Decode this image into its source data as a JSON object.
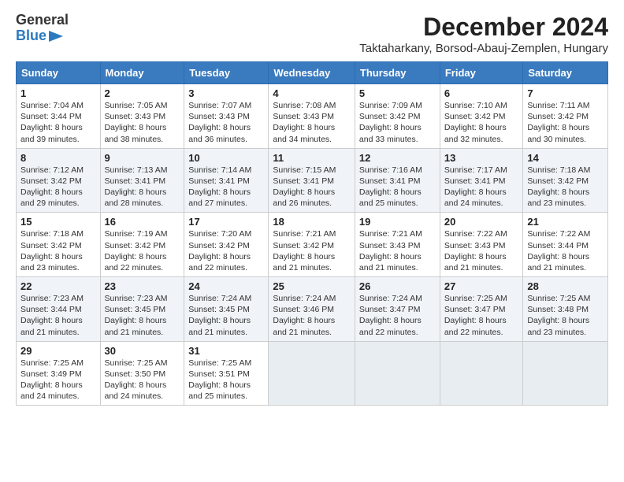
{
  "logo": {
    "general": "General",
    "blue": "Blue"
  },
  "title": "December 2024",
  "location": "Taktaharkany, Borsod-Abauj-Zemplen, Hungary",
  "days_of_week": [
    "Sunday",
    "Monday",
    "Tuesday",
    "Wednesday",
    "Thursday",
    "Friday",
    "Saturday"
  ],
  "weeks": [
    [
      {
        "day": "1",
        "sunrise": "7:04 AM",
        "sunset": "3:44 PM",
        "daylight": "8 hours and 39 minutes."
      },
      {
        "day": "2",
        "sunrise": "7:05 AM",
        "sunset": "3:43 PM",
        "daylight": "8 hours and 38 minutes."
      },
      {
        "day": "3",
        "sunrise": "7:07 AM",
        "sunset": "3:43 PM",
        "daylight": "8 hours and 36 minutes."
      },
      {
        "day": "4",
        "sunrise": "7:08 AM",
        "sunset": "3:43 PM",
        "daylight": "8 hours and 34 minutes."
      },
      {
        "day": "5",
        "sunrise": "7:09 AM",
        "sunset": "3:42 PM",
        "daylight": "8 hours and 33 minutes."
      },
      {
        "day": "6",
        "sunrise": "7:10 AM",
        "sunset": "3:42 PM",
        "daylight": "8 hours and 32 minutes."
      },
      {
        "day": "7",
        "sunrise": "7:11 AM",
        "sunset": "3:42 PM",
        "daylight": "8 hours and 30 minutes."
      }
    ],
    [
      {
        "day": "8",
        "sunrise": "7:12 AM",
        "sunset": "3:42 PM",
        "daylight": "8 hours and 29 minutes."
      },
      {
        "day": "9",
        "sunrise": "7:13 AM",
        "sunset": "3:41 PM",
        "daylight": "8 hours and 28 minutes."
      },
      {
        "day": "10",
        "sunrise": "7:14 AM",
        "sunset": "3:41 PM",
        "daylight": "8 hours and 27 minutes."
      },
      {
        "day": "11",
        "sunrise": "7:15 AM",
        "sunset": "3:41 PM",
        "daylight": "8 hours and 26 minutes."
      },
      {
        "day": "12",
        "sunrise": "7:16 AM",
        "sunset": "3:41 PM",
        "daylight": "8 hours and 25 minutes."
      },
      {
        "day": "13",
        "sunrise": "7:17 AM",
        "sunset": "3:41 PM",
        "daylight": "8 hours and 24 minutes."
      },
      {
        "day": "14",
        "sunrise": "7:18 AM",
        "sunset": "3:42 PM",
        "daylight": "8 hours and 23 minutes."
      }
    ],
    [
      {
        "day": "15",
        "sunrise": "7:18 AM",
        "sunset": "3:42 PM",
        "daylight": "8 hours and 23 minutes."
      },
      {
        "day": "16",
        "sunrise": "7:19 AM",
        "sunset": "3:42 PM",
        "daylight": "8 hours and 22 minutes."
      },
      {
        "day": "17",
        "sunrise": "7:20 AM",
        "sunset": "3:42 PM",
        "daylight": "8 hours and 22 minutes."
      },
      {
        "day": "18",
        "sunrise": "7:21 AM",
        "sunset": "3:42 PM",
        "daylight": "8 hours and 21 minutes."
      },
      {
        "day": "19",
        "sunrise": "7:21 AM",
        "sunset": "3:43 PM",
        "daylight": "8 hours and 21 minutes."
      },
      {
        "day": "20",
        "sunrise": "7:22 AM",
        "sunset": "3:43 PM",
        "daylight": "8 hours and 21 minutes."
      },
      {
        "day": "21",
        "sunrise": "7:22 AM",
        "sunset": "3:44 PM",
        "daylight": "8 hours and 21 minutes."
      }
    ],
    [
      {
        "day": "22",
        "sunrise": "7:23 AM",
        "sunset": "3:44 PM",
        "daylight": "8 hours and 21 minutes."
      },
      {
        "day": "23",
        "sunrise": "7:23 AM",
        "sunset": "3:45 PM",
        "daylight": "8 hours and 21 minutes."
      },
      {
        "day": "24",
        "sunrise": "7:24 AM",
        "sunset": "3:45 PM",
        "daylight": "8 hours and 21 minutes."
      },
      {
        "day": "25",
        "sunrise": "7:24 AM",
        "sunset": "3:46 PM",
        "daylight": "8 hours and 21 minutes."
      },
      {
        "day": "26",
        "sunrise": "7:24 AM",
        "sunset": "3:47 PM",
        "daylight": "8 hours and 22 minutes."
      },
      {
        "day": "27",
        "sunrise": "7:25 AM",
        "sunset": "3:47 PM",
        "daylight": "8 hours and 22 minutes."
      },
      {
        "day": "28",
        "sunrise": "7:25 AM",
        "sunset": "3:48 PM",
        "daylight": "8 hours and 23 minutes."
      }
    ],
    [
      {
        "day": "29",
        "sunrise": "7:25 AM",
        "sunset": "3:49 PM",
        "daylight": "8 hours and 24 minutes."
      },
      {
        "day": "30",
        "sunrise": "7:25 AM",
        "sunset": "3:50 PM",
        "daylight": "8 hours and 24 minutes."
      },
      {
        "day": "31",
        "sunrise": "7:25 AM",
        "sunset": "3:51 PM",
        "daylight": "8 hours and 25 minutes."
      },
      null,
      null,
      null,
      null
    ]
  ]
}
